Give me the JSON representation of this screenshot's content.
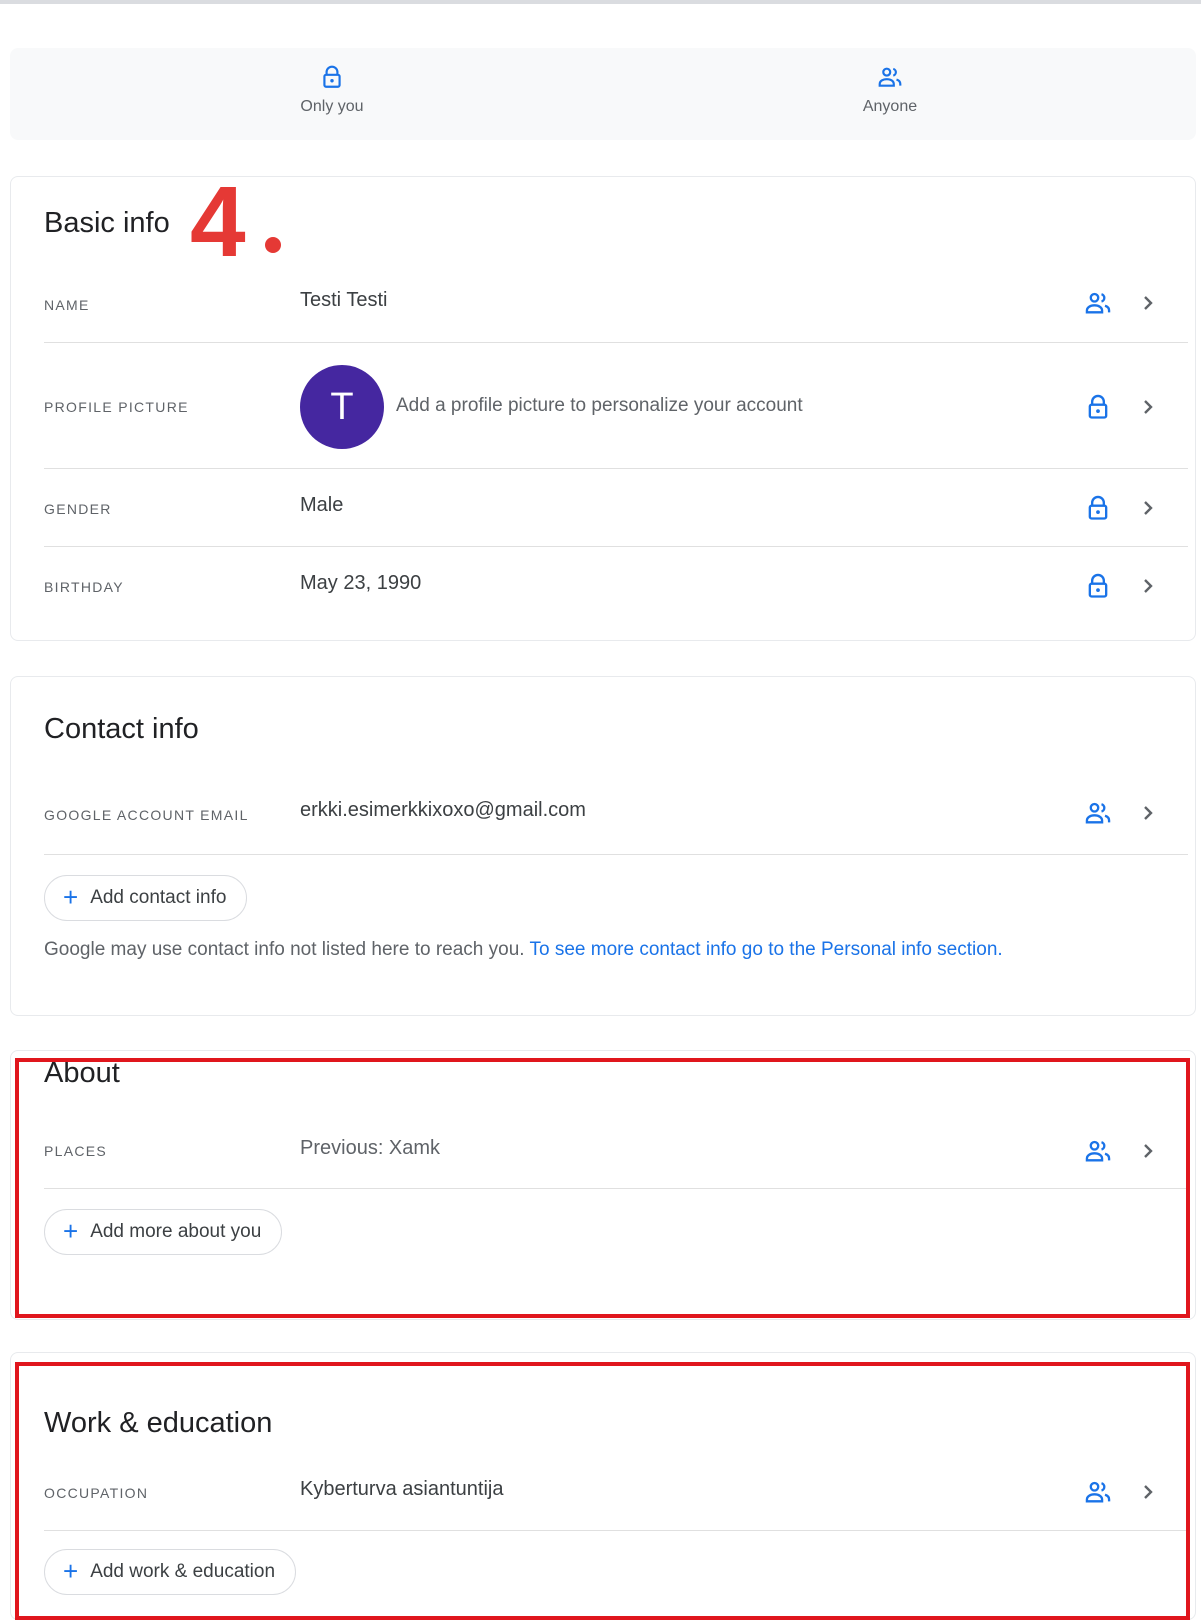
{
  "visibility_legend": {
    "only_you": {
      "label": "Only you",
      "icon": "lock-icon"
    },
    "anyone": {
      "label": "Anyone",
      "icon": "people-icon"
    }
  },
  "annotation": {
    "step_number": "4",
    "color": "#e53935"
  },
  "colors": {
    "accent": "#1a73e8",
    "avatar": "#4527a0",
    "highlight": "#e0161d"
  },
  "basic_info": {
    "title": "Basic info",
    "rows": [
      {
        "label": "NAME",
        "value": "Testi Testi",
        "visibility": "people-icon"
      },
      {
        "label": "PROFILE PICTURE",
        "avatar_letter": "T",
        "value": "Add a profile picture to personalize your account",
        "visibility": "lock-icon"
      },
      {
        "label": "GENDER",
        "value": "Male",
        "visibility": "lock-icon"
      },
      {
        "label": "BIRTHDAY",
        "value": "May 23, 1990",
        "visibility": "lock-icon"
      }
    ]
  },
  "contact_info": {
    "title": "Contact info",
    "rows": [
      {
        "label": "GOOGLE ACCOUNT EMAIL",
        "value": "erkki.esimerkkixoxo@gmail.com",
        "visibility": "people-icon"
      }
    ],
    "add_button": "Add contact info",
    "note": "Google may use contact info not listed here to reach you.",
    "note_link": "To see more contact info go to the Personal info section."
  },
  "about": {
    "title": "About",
    "rows": [
      {
        "label": "PLACES",
        "value": "Previous: Xamk",
        "visibility": "people-icon"
      }
    ],
    "add_button": "Add more about you"
  },
  "work_education": {
    "title": "Work & education",
    "rows": [
      {
        "label": "OCCUPATION",
        "value": "Kyberturva asiantuntija",
        "visibility": "people-icon"
      }
    ],
    "add_button": "Add work & education"
  }
}
